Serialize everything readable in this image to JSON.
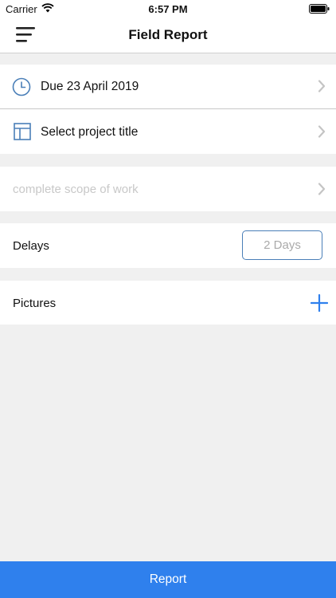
{
  "status_bar": {
    "carrier": "Carrier",
    "time": "6:57 PM"
  },
  "header": {
    "title": "Field Report"
  },
  "due": {
    "label": "Due 23 April 2019"
  },
  "project": {
    "label": "Select project title"
  },
  "scope": {
    "placeholder": "complete scope of work"
  },
  "delays": {
    "label": "Delays",
    "value": "2 Days"
  },
  "pictures": {
    "label": "Pictures"
  },
  "footer": {
    "report_label": "Report"
  },
  "colors": {
    "accent": "#2f80ed",
    "icon_blue": "#4a7fb8"
  }
}
